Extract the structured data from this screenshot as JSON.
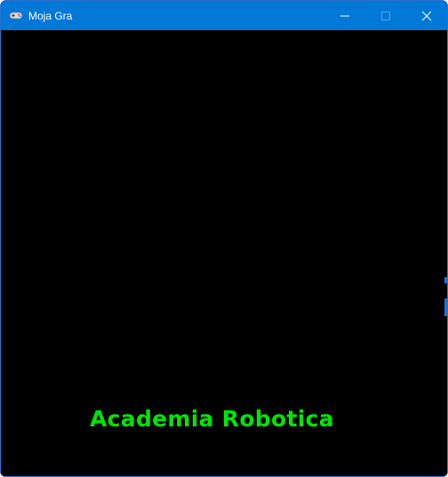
{
  "window": {
    "title": "Moja Gra",
    "icon": "gamepad-icon",
    "controls": {
      "minimize_icon": "minimize-icon",
      "maximize_icon": "maximize-icon",
      "close_icon": "close-icon"
    }
  },
  "game": {
    "text": "Academia Robotica",
    "text_color": "#00e600",
    "background": "#000000"
  },
  "colors": {
    "titlebar": "#0078d7",
    "border": "#2b6fcc"
  }
}
